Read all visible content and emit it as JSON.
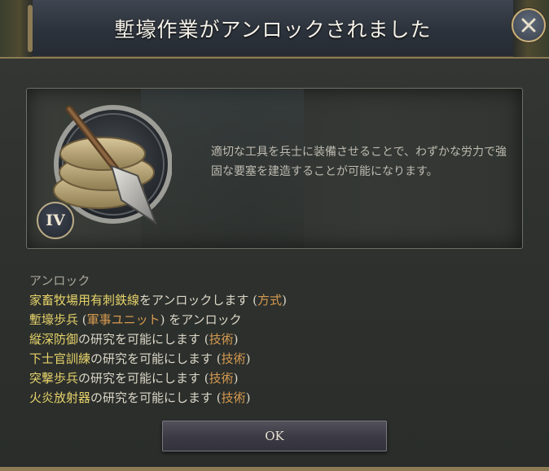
{
  "dialog": {
    "title": "塹壕作業がアンロックされました",
    "rank": "IV",
    "description": "適切な工具を兵士に装備させることで、わずかな労力で強固な要塞を建造することが可能になります。",
    "effects_header": "アンロック",
    "effects": [
      {
        "name": "家畜牧場用有刺鉄線",
        "mid": "をアンロックします (",
        "tag": "方式",
        "end": ")"
      },
      {
        "name": "塹壕歩兵",
        "mid": " (",
        "tag": "軍事ユニット",
        "end": ") をアンロック"
      },
      {
        "name": "縦深防御",
        "mid": "の研究を可能にします (",
        "tag": "技術",
        "end": ")"
      },
      {
        "name": "下士官訓練",
        "mid": "の研究を可能にします (",
        "tag": "技術",
        "end": ")"
      },
      {
        "name": "突撃歩兵",
        "mid": "の研究を可能にします (",
        "tag": "技術",
        "end": ")"
      },
      {
        "name": "火炎放射器",
        "mid": "の研究を可能にします (",
        "tag": "技術",
        "end": ")"
      }
    ],
    "ok_label": "OK",
    "close_icon": "close-x-icon"
  },
  "colors": {
    "effect_name": "#e6d36a",
    "effect_tag": "#d59a4f",
    "frame_gold": "#8c7b55"
  }
}
